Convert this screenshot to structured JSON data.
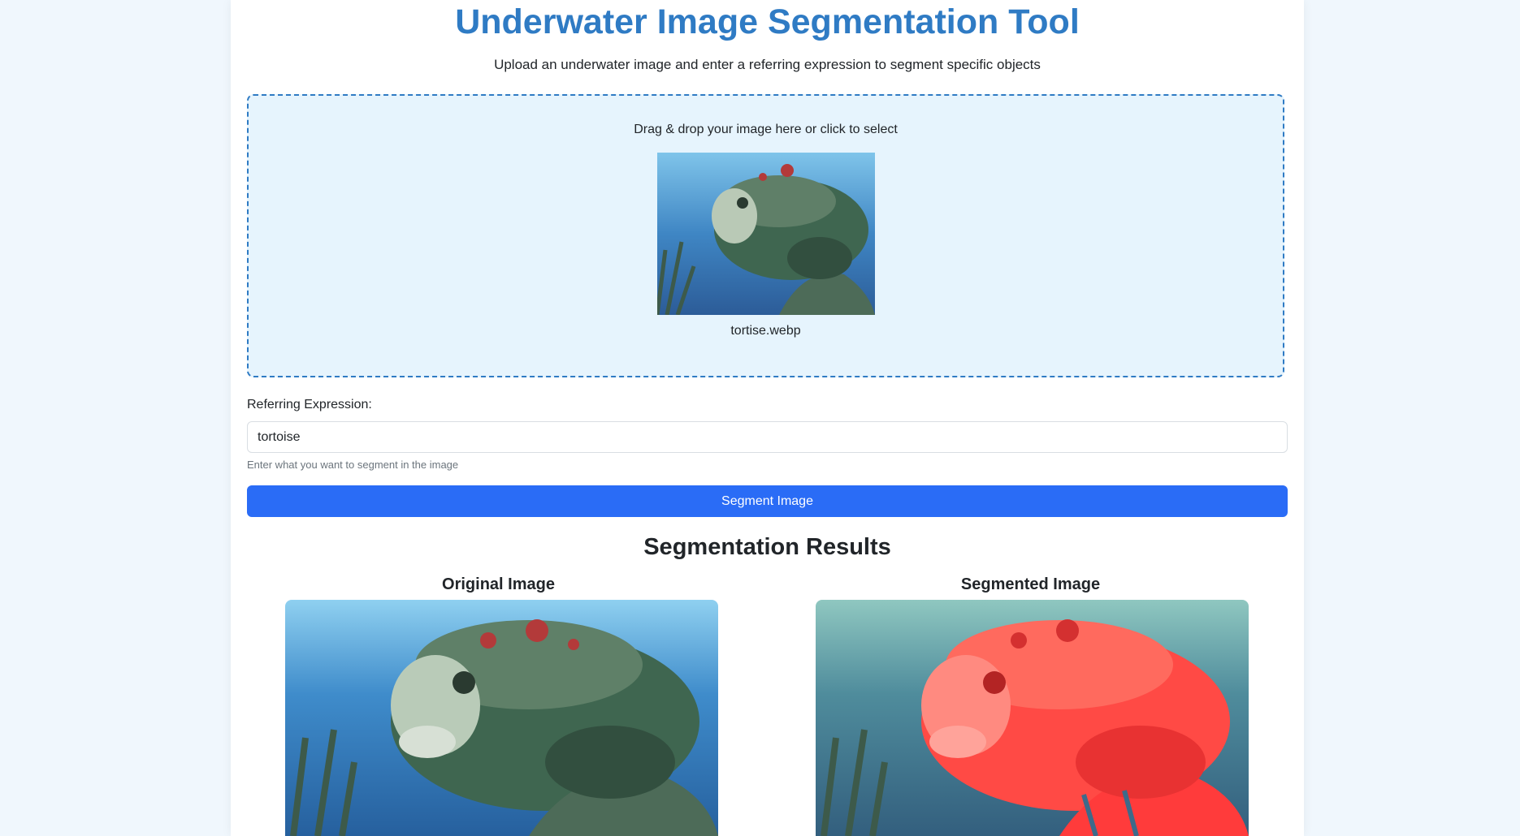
{
  "header": {
    "title": "Underwater Image Segmentation Tool",
    "subtitle": "Upload an underwater image and enter a referring expression to segment specific objects"
  },
  "upload": {
    "prompt": "Drag & drop your image here or click to select",
    "filename": "tortise.webp"
  },
  "form": {
    "label": "Referring Expression:",
    "value": "tortoise",
    "help": "Enter what you want to segment in the image",
    "button_label": "Segment Image"
  },
  "results": {
    "title": "Segmentation Results",
    "original_label": "Original Image",
    "segmented_label": "Segmented Image"
  },
  "colors": {
    "accent": "#2f7bc4",
    "button": "#2a6cf6",
    "dropzone_bg": "#e6f4fd",
    "mask": "#ff3b3b"
  }
}
